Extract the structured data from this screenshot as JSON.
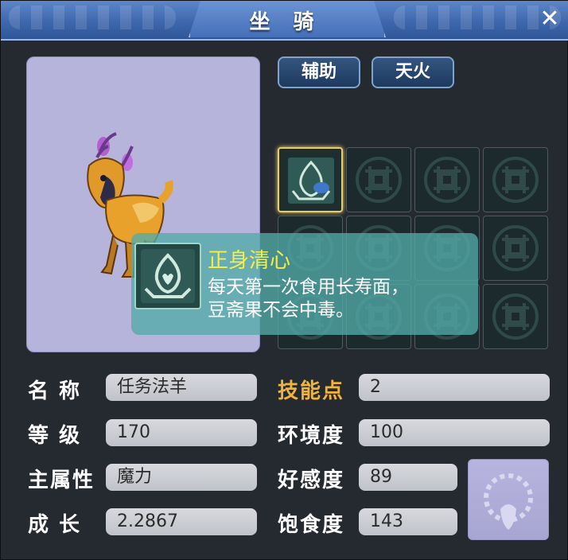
{
  "window": {
    "title": "坐 骑",
    "close_label": "✕"
  },
  "tabs": [
    {
      "label": "辅助"
    },
    {
      "label": "天火"
    }
  ],
  "skill_tooltip": {
    "name": "正身清心",
    "description_line1": "每天第一次食用长寿面，",
    "description_line2": "豆斋果不会中毒。"
  },
  "stats": {
    "name_label": "名 称",
    "name_value": "任务法羊",
    "level_label": "等 级",
    "level_value": "170",
    "attr_label": "主属性",
    "attr_value": "魔力",
    "growth_label": "成 长",
    "growth_value": "2.2867",
    "skill_points_label": "技能点",
    "skill_points_value": "2",
    "environment_label": "环境度",
    "environment_value": "100",
    "favor_label": "好感度",
    "favor_value": "89",
    "satiety_label": "饱食度",
    "satiety_value": "143"
  },
  "icons": {
    "close": "close-icon",
    "empty_slot": "locked-slot-emblem-icon",
    "skill": "skill-zhengshenqingxin-icon",
    "orb": "decoration-ring-icon"
  },
  "colors": {
    "title_bar": "#4a73b8",
    "panel_bg": "#252a31",
    "tooltip_title": "#f6ef44",
    "highlight_label": "#f1b338",
    "slot_border_active": "#e9cf63"
  }
}
